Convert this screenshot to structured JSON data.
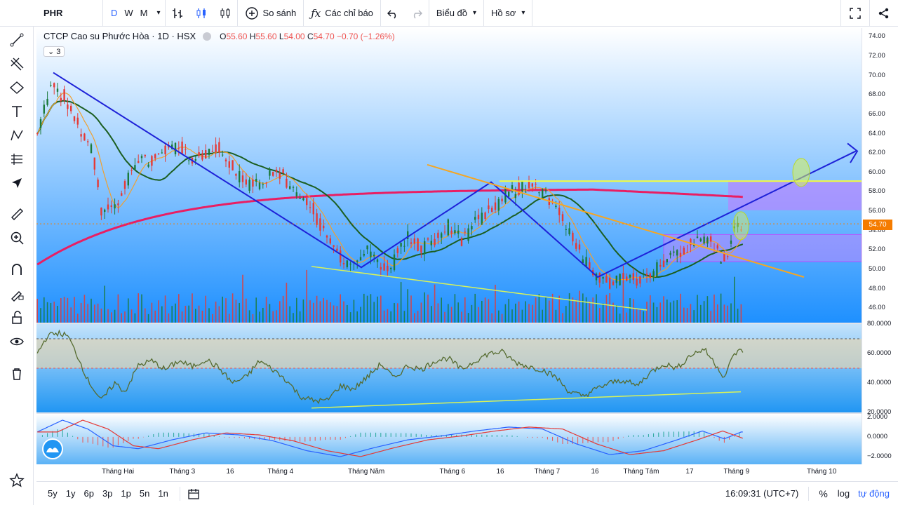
{
  "toolbar": {
    "symbol": "PHR",
    "intervals": [
      "D",
      "W",
      "M"
    ],
    "compare_label": "So sánh",
    "indicators_label": "Các chỉ báo",
    "chart_label": "Biểu đồ",
    "profile_label": "Hồ sơ"
  },
  "legend": {
    "title": "CTCP Cao su Phước Hòa · 1D · HSX",
    "open_label": "O",
    "open": "55.60",
    "high_label": "H",
    "high": "55.60",
    "low_label": "L",
    "low": "54.00",
    "close_label": "C",
    "close": "54.70",
    "change": "−0.70 (−1.26%)",
    "collapsed_count": "3"
  },
  "price_scale": [
    "74.00",
    "72.00",
    "70.00",
    "68.00",
    "66.00",
    "64.00",
    "62.00",
    "60.00",
    "58.00",
    "56.00",
    "54.00",
    "52.00",
    "50.00",
    "48.00",
    "46.00"
  ],
  "last_price": "54.70",
  "rsi_scale": [
    "80.0000",
    "60.0000",
    "40.0000",
    "20.0000"
  ],
  "macd_scale": [
    "2.0000",
    "0.0000",
    "−2.0000"
  ],
  "time_axis": [
    "Tháng Hai",
    "Tháng 3",
    "16",
    "Tháng 4",
    "Tháng Năm",
    "Tháng 6",
    "16",
    "Tháng 7",
    "16",
    "Tháng Tám",
    "17",
    "Tháng 9",
    "Tháng 10"
  ],
  "bottom": {
    "ranges": [
      "5y",
      "1y",
      "6p",
      "3p",
      "1p",
      "5n",
      "1n"
    ],
    "time": "16:09:31 (UTC+7)",
    "percent": "%",
    "log": "log",
    "auto": "tự động"
  },
  "colors": {
    "up": "#26a69a",
    "down": "#ef5350",
    "ma_long": "#e91e63",
    "ma_mid": "#1b5e20",
    "ma_short": "#f0a030",
    "trend": "#1e22d8",
    "resistance": "#f5a623",
    "zone": "#b388ff",
    "bg_top": "#ffffff",
    "bg_bottom": "#2196f3"
  },
  "chart_data": {
    "type": "candlestick",
    "price_range": [
      44.5,
      74.9
    ],
    "rsi_range": [
      20,
      80
    ],
    "rsi_bands": [
      50,
      70
    ],
    "macd_range": [
      -2.5,
      2.2
    ],
    "anchor_close": [
      [
        0,
        64
      ],
      [
        8,
        69.5
      ],
      [
        16,
        67.5
      ],
      [
        24,
        65
      ],
      [
        32,
        62.5
      ],
      [
        38,
        56
      ],
      [
        46,
        56.5
      ],
      [
        54,
        59.5
      ],
      [
        60,
        61.5
      ],
      [
        68,
        61
      ],
      [
        76,
        62.5
      ],
      [
        84,
        63
      ],
      [
        92,
        61.5
      ],
      [
        100,
        62
      ],
      [
        108,
        62.5
      ],
      [
        116,
        60.5
      ],
      [
        124,
        58.5
      ],
      [
        132,
        59
      ],
      [
        140,
        60
      ],
      [
        148,
        59
      ],
      [
        156,
        57.5
      ],
      [
        164,
        56
      ],
      [
        172,
        53
      ],
      [
        180,
        51
      ],
      [
        188,
        50.5
      ],
      [
        196,
        52
      ],
      [
        204,
        50
      ],
      [
        212,
        51
      ],
      [
        220,
        53.5
      ],
      [
        228,
        52
      ],
      [
        236,
        53
      ],
      [
        244,
        54.5
      ],
      [
        252,
        53
      ],
      [
        260,
        55
      ],
      [
        268,
        56
      ],
      [
        276,
        57.5
      ],
      [
        284,
        58.2
      ],
      [
        292,
        58.8
      ],
      [
        300,
        57.8
      ],
      [
        306,
        57
      ],
      [
        312,
        55
      ],
      [
        318,
        53
      ],
      [
        324,
        51
      ],
      [
        332,
        49.5
      ],
      [
        340,
        48.5
      ],
      [
        348,
        49
      ],
      [
        356,
        48.8
      ],
      [
        364,
        49.5
      ],
      [
        372,
        50.8
      ],
      [
        380,
        51.5
      ],
      [
        388,
        52.5
      ],
      [
        394,
        53.5
      ],
      [
        400,
        52.5
      ],
      [
        406,
        51
      ],
      [
        410,
        51.5
      ],
      [
        414,
        55
      ],
      [
        418,
        54.7
      ]
    ],
    "volume_range": [
      0,
      100
    ],
    "rsi_anchor": [
      [
        0,
        60
      ],
      [
        6,
        72
      ],
      [
        12,
        74
      ],
      [
        18,
        72
      ],
      [
        24,
        58
      ],
      [
        30,
        42
      ],
      [
        38,
        28
      ],
      [
        46,
        40
      ],
      [
        52,
        34
      ],
      [
        60,
        52
      ],
      [
        68,
        55
      ],
      [
        76,
        49
      ],
      [
        84,
        55
      ],
      [
        92,
        51
      ],
      [
        100,
        56
      ],
      [
        108,
        50
      ],
      [
        116,
        40
      ],
      [
        124,
        44
      ],
      [
        132,
        55
      ],
      [
        140,
        49
      ],
      [
        148,
        42
      ],
      [
        156,
        31
      ],
      [
        164,
        28
      ],
      [
        172,
        28
      ],
      [
        180,
        38
      ],
      [
        188,
        36
      ],
      [
        196,
        44
      ],
      [
        204,
        53
      ],
      [
        212,
        43
      ],
      [
        220,
        52
      ],
      [
        228,
        49
      ],
      [
        236,
        55
      ],
      [
        244,
        57
      ],
      [
        252,
        49
      ],
      [
        260,
        55
      ],
      [
        268,
        60
      ],
      [
        276,
        61
      ],
      [
        284,
        54
      ],
      [
        292,
        51
      ],
      [
        300,
        49
      ],
      [
        308,
        44
      ],
      [
        316,
        34
      ],
      [
        324,
        31
      ],
      [
        332,
        36
      ],
      [
        340,
        40
      ],
      [
        348,
        42
      ],
      [
        356,
        38
      ],
      [
        364,
        47
      ],
      [
        372,
        53
      ],
      [
        380,
        50
      ],
      [
        388,
        59
      ],
      [
        396,
        63
      ],
      [
        402,
        54
      ],
      [
        408,
        44
      ],
      [
        414,
        60
      ],
      [
        418,
        62
      ]
    ],
    "macd_anchor": [
      [
        0,
        0.5
      ],
      [
        15,
        1.7
      ],
      [
        30,
        0.8
      ],
      [
        45,
        -0.9
      ],
      [
        60,
        -1.2
      ],
      [
        80,
        -0.3
      ],
      [
        100,
        0.4
      ],
      [
        120,
        0.2
      ],
      [
        140,
        -0.4
      ],
      [
        160,
        -1.4
      ],
      [
        180,
        -2.0
      ],
      [
        200,
        -1.1
      ],
      [
        220,
        -0.3
      ],
      [
        240,
        0.1
      ],
      [
        260,
        0.6
      ],
      [
        280,
        1.0
      ],
      [
        300,
        0.8
      ],
      [
        320,
        -0.7
      ],
      [
        340,
        -1.8
      ],
      [
        360,
        -1.4
      ],
      [
        380,
        -0.3
      ],
      [
        395,
        0.6
      ],
      [
        408,
        -0.2
      ],
      [
        418,
        0.5
      ]
    ]
  }
}
